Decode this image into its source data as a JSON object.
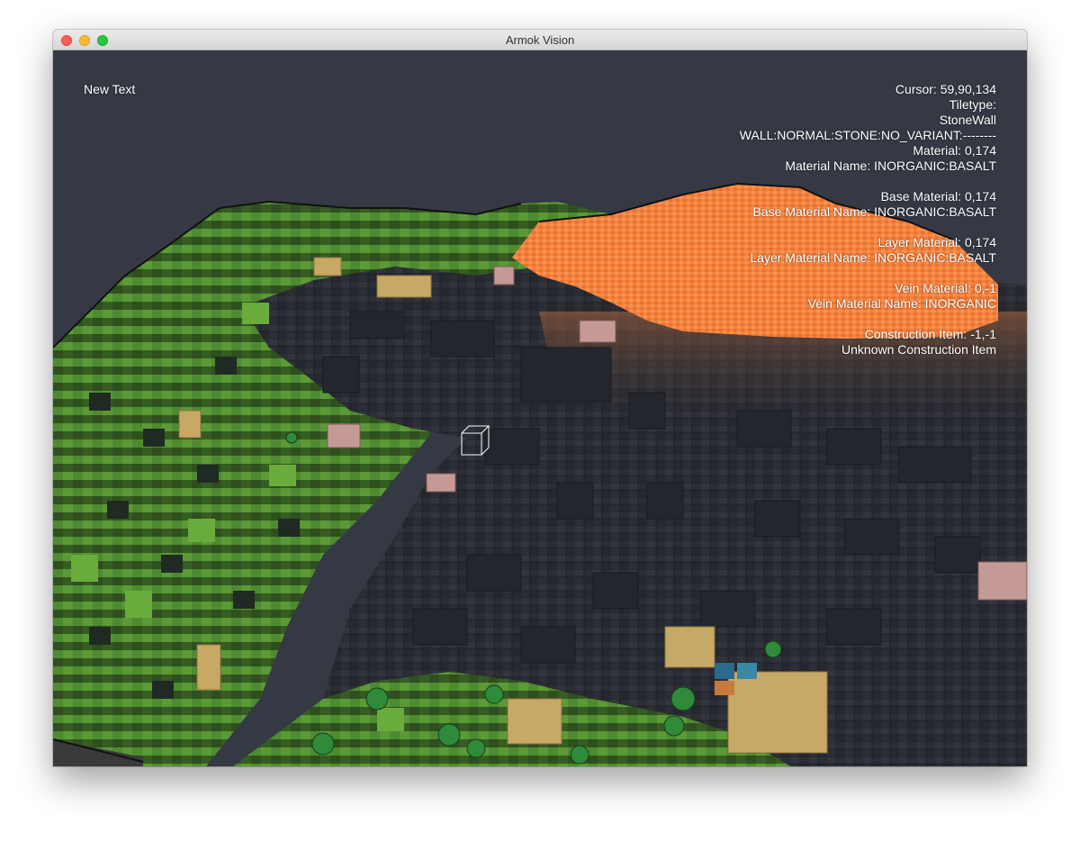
{
  "window": {
    "title": "Armok Vision"
  },
  "hud": {
    "left_text": "New Text",
    "info_lines": [
      "Cursor: 59,90,134",
      "Tiletype:",
      "StoneWall",
      "WALL:NORMAL:STONE:NO_VARIANT:--------",
      "Material: 0,174",
      "Material Name: INORGANIC:BASALT",
      "",
      "Base Material: 0,174",
      "Base Material Name: INORGANIC:BASALT",
      "",
      "Layer Material: 0,174",
      "Layer Material Name: INORGANIC:BASALT",
      "",
      "Vein Material: 0,-1",
      "Vein Material Name: INORGANIC",
      "",
      "Construction Item: -1,-1",
      "Unknown Construction Item"
    ]
  },
  "colors": {
    "sky": "#353944",
    "grass": "#4a7a2c",
    "stone": "#2d2f37",
    "lava": "#f07c3c",
    "sand": "#c8a865"
  }
}
